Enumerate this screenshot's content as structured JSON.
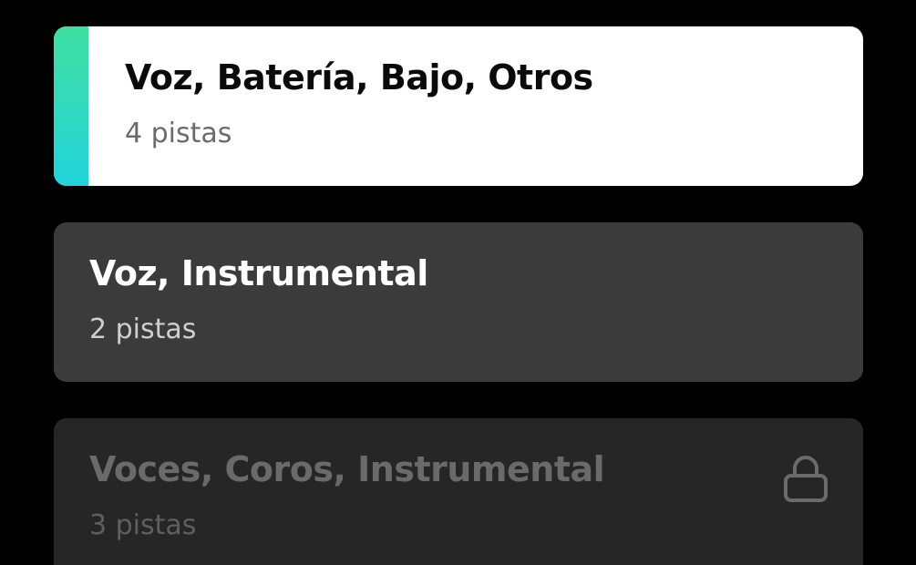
{
  "options": [
    {
      "title": "Voz, Batería, Bajo, Otros",
      "subtitle": "4 pistas",
      "selected": true,
      "locked": false
    },
    {
      "title": "Voz, Instrumental",
      "subtitle": "2 pistas",
      "selected": false,
      "locked": false
    },
    {
      "title": "Voces, Coros, Instrumental",
      "subtitle": "3 pistas",
      "selected": false,
      "locked": true
    }
  ],
  "colors": {
    "background": "#000000",
    "selected_card": "#ffffff",
    "card": "#3b3b3b",
    "locked_card": "#262626",
    "accent_gradient_top": "#3fe0a0",
    "accent_gradient_bottom": "#20d4dc"
  },
  "icons": {
    "lock": "lock-icon"
  }
}
